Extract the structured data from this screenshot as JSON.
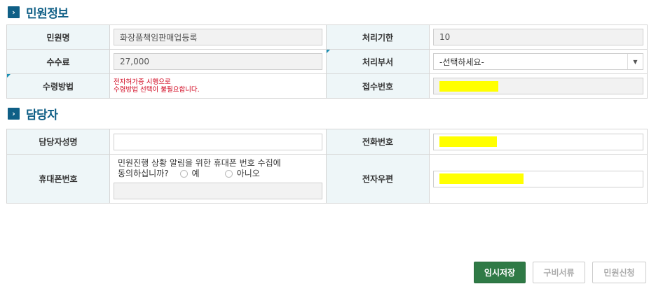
{
  "sections": {
    "civil_info": "민원정보",
    "manager": "담당자"
  },
  "civil_info": {
    "name_label": "민원명",
    "name_value": "화장품책임판매업등록",
    "deadline_label": "처리기한",
    "deadline_value": "10",
    "fee_label": "수수료",
    "fee_value": "27,000",
    "dept_label": "처리부서",
    "dept_selected": "-선택하세요-",
    "receive_label": "수령방법",
    "receive_note_line1": "전자허가증 시행으로",
    "receive_note_line2": "수령방법 선택이 불필요합니다.",
    "receipt_label": "접수번호"
  },
  "manager": {
    "name_label": "담당자성명",
    "name_value": "",
    "phone_label": "전화번호",
    "mobile_label": "휴대폰번호",
    "consent_line1": "민원진행 상황 알림을 위한 휴대폰 번호 수집에",
    "consent_line2": "동의하십니까?",
    "yes_label": "예",
    "no_label": "아니오",
    "mobile_value": "",
    "email_label": "전자우편"
  },
  "buttons": {
    "temp_save": "임시저장",
    "documents": "구비서류",
    "apply": "민원신청"
  },
  "colors": {
    "accent": "#0f5f86",
    "label_bg": "#eef6f8",
    "primary_button": "#2f7a46",
    "highlight": "#ffff00",
    "notice": "#d0021b"
  }
}
